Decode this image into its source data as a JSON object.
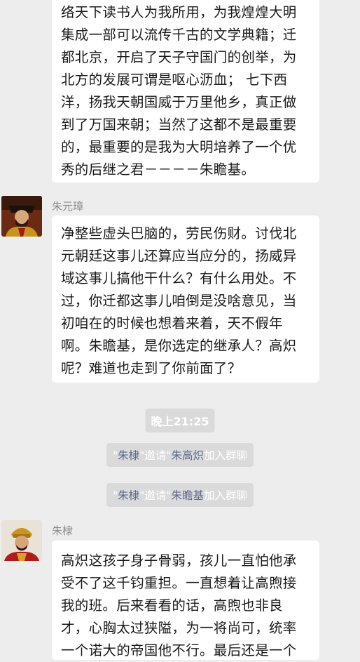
{
  "messages": [
    {
      "lines": [
        "络天下读书人为我所用，为我煌煌大明",
        "集成一部可以流传千古的文学典籍；迁",
        "都北京，开启了天子守国门的创举，为",
        "北方的发展可谓是呕心沥血；  七下西",
        "洋，扬我天朝国威于万里他乡，真正做",
        "到了万国来朝；当然了这都不是最重要",
        "的，最重要的是我为大明培养了一个优",
        "秀的后继之君－－－－朱瞻基。"
      ]
    },
    {
      "sender": "朱元璋",
      "lines": [
        "净整些虚头巴脑的，劳民伤财。讨伐北",
        "元朝廷这事儿还算应当应分的，扬威异",
        "域这事儿搞他干什么？有什么用处。不",
        "过，你迁都这事儿咱倒是没啥意见，当",
        "初咱在的时候也想着来着，天不假年",
        "啊。朱瞻基，是你选定的继承人？高炽",
        "呢？难道也走到了你前面了？"
      ]
    },
    {
      "sender": "朱棣",
      "lines": [
        "高炽这孩子身子骨弱，孩儿一直怕他承",
        "受不了这千钧重担。一直想着让高煦接",
        "我的班。后来看看的话，高煦也非良",
        "才，心胸太过狭隘，为一将尚可，统率",
        "一个诺大的帝国他不行。最后还是一个"
      ]
    }
  ],
  "timestamp": "晚上21:25",
  "system_notices": [
    {
      "q1": "\"",
      "actor": "朱棣",
      "q2": "\"",
      "verb": "邀请",
      "q3": "\"",
      "target": "朱高炽",
      "suffix": "加入群聊"
    },
    {
      "q1": "\"",
      "actor": "朱棣",
      "q2": "\"",
      "verb": "邀请",
      "q3": "\"",
      "target": "朱瞻基",
      "suffix": "加入群聊"
    }
  ],
  "colors": {
    "background": "#ededed",
    "bubble": "#ffffff",
    "system_notice_bg": "#dadada",
    "link_name": "#5b6a8f",
    "sender_name": "#8c8c8c"
  }
}
